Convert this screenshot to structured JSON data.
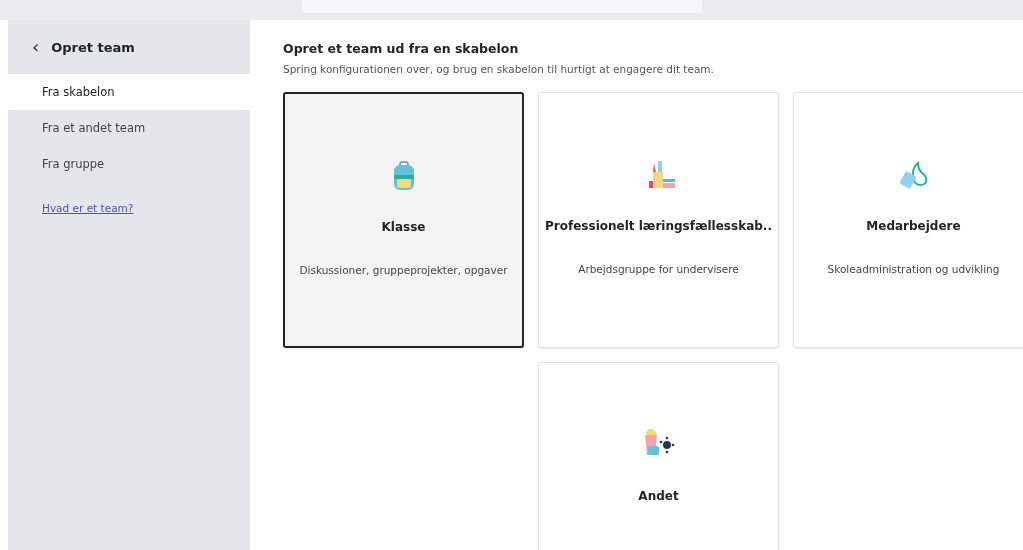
{
  "sidebar": {
    "back_icon": "‹",
    "title": "Opret team",
    "items": [
      {
        "label": "Fra skabelon",
        "selected": true
      },
      {
        "label": "Fra et andet team",
        "selected": false
      },
      {
        "label": "Fra gruppe",
        "selected": false
      }
    ],
    "link": "Hvad er et team?"
  },
  "main": {
    "title": "Opret et team ud fra en skabelon",
    "subtitle": "Spring konfigurationen over, og brug en skabelon til hurtigt at engagere dit team.",
    "templates": [
      {
        "kind": "backpack",
        "name": "Klasse",
        "description": "Diskussioner, gruppeprojekter, opgaver",
        "selected": true
      },
      {
        "kind": "books",
        "name": "Professionelt læringsfællesskab..",
        "description": "Arbejdsgruppe for undervisere",
        "selected": false
      },
      {
        "kind": "badge",
        "name": "Medarbejdere",
        "description": "Skoleadministration og udvikling",
        "selected": false
      },
      {
        "kind": "fun",
        "name": "Andet",
        "selected": false
      }
    ]
  }
}
